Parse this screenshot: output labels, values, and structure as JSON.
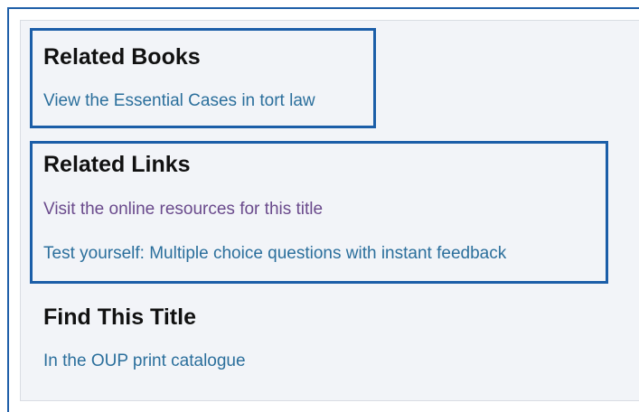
{
  "related_books": {
    "heading": "Related Books",
    "links": [
      "View the Essential Cases in tort law"
    ]
  },
  "related_links": {
    "heading": "Related Links",
    "links": [
      "Visit the online resources for this title",
      "Test yourself: Multiple choice questions with instant feedback"
    ]
  },
  "find_this_title": {
    "heading": "Find This Title",
    "links": [
      "In the OUP print catalogue"
    ]
  },
  "colors": {
    "link": "#2b6f9c",
    "visited_link": "#6a4a8c",
    "highlight_border": "#1b5ea8",
    "panel_background": "#f2f4f8"
  }
}
